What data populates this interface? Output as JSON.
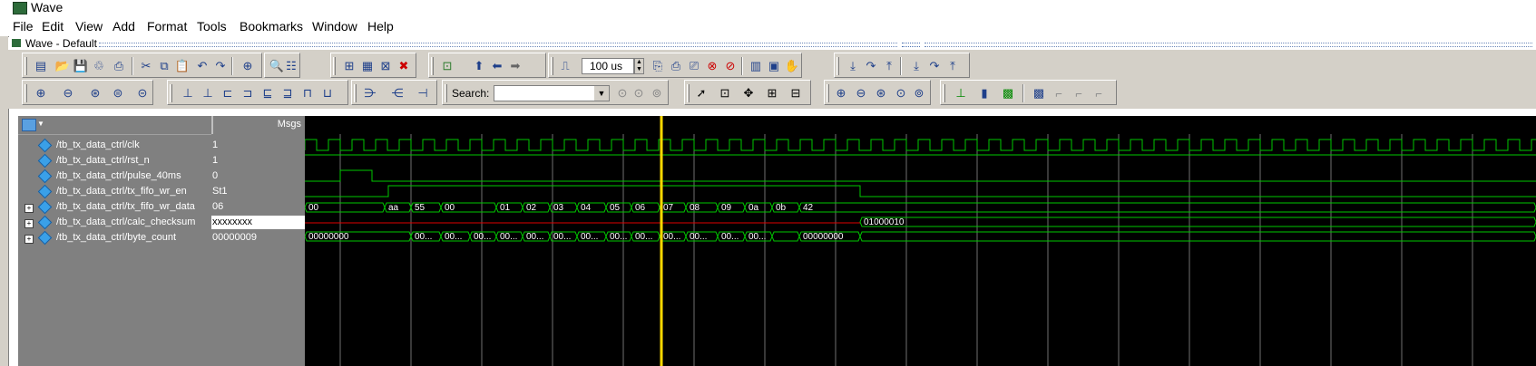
{
  "window": {
    "title": "Wave"
  },
  "menu": [
    "File",
    "Edit",
    "View",
    "Add",
    "Format",
    "Tools",
    "Bookmarks",
    "Window",
    "Help"
  ],
  "pane": {
    "title": "Wave - Default"
  },
  "toolbar": {
    "time_value": "100 us",
    "search_label": "Search:",
    "search_value": "",
    "icons_row1": [
      "new-icon",
      "open-icon",
      "save-icon",
      "reload-icon",
      "print-icon",
      "cut-icon",
      "copy-icon",
      "paste-icon",
      "undo-icon",
      "redo-icon",
      "add-icon",
      "find-icon",
      "format-icon",
      "compile-icon",
      "simulate-icon",
      "break-icon",
      "stop-icon",
      "restart-icon",
      "up-icon",
      "back-icon",
      "forward-icon",
      "run-length-icon",
      "run-icon",
      "continue-icon",
      "run-all-icon",
      "break-all-icon",
      "stop-sim-icon",
      "performance-icon",
      "memory-icon",
      "hand-icon",
      "step-into-icon",
      "step-over-icon",
      "step-out-icon",
      "step-into-2-icon",
      "step-over-2-icon",
      "step-out-2-icon"
    ],
    "icons_row2": [
      "insert-cursor-icon",
      "delete-cursor-icon",
      "lock-cursor-icon",
      "cursor-edit-icon",
      "cursor-goto-icon",
      "edge-prev-icon",
      "edge-next-icon",
      "falling-edge-icon",
      "rising-edge-icon",
      "glitch-icon",
      "edge-any-icon",
      "edge-neg-icon",
      "expand-icon",
      "collapse-icon",
      "group-icon",
      "search-prev-icon",
      "search-next-icon",
      "search-options-icon",
      "select-icon",
      "zoom-box-icon",
      "move-icon",
      "dataflow-icon",
      "schematic-icon",
      "zoom-in-icon",
      "zoom-out-icon",
      "zoom-full-icon",
      "zoom-cursor-icon",
      "zoom-region-icon",
      "wave-1-icon",
      "wave-2-icon",
      "wave-3-icon",
      "wave-4-icon",
      "wave-5-icon",
      "wave-6-icon",
      "wave-7-icon"
    ]
  },
  "columns": {
    "msgs_label": "Msgs"
  },
  "signals": [
    {
      "name": "/tb_tx_data_ctrl/clk",
      "value": "1",
      "expandable": false
    },
    {
      "name": "/tb_tx_data_ctrl/rst_n",
      "value": "1",
      "expandable": false
    },
    {
      "name": "/tb_tx_data_ctrl/pulse_40ms",
      "value": "0",
      "expandable": false
    },
    {
      "name": "/tb_tx_data_ctrl/tx_fifo_wr_en",
      "value": "St1",
      "expandable": false
    },
    {
      "name": "/tb_tx_data_ctrl/tx_fifo_wr_data",
      "value": "06",
      "expandable": true
    },
    {
      "name": "/tb_tx_data_ctrl/calc_checksum",
      "value": "xxxxxxxx",
      "expandable": true,
      "selected": true
    },
    {
      "name": "/tb_tx_data_ctrl/byte_count",
      "value": "00000009",
      "expandable": true
    }
  ],
  "wave": {
    "data_bus_labels": [
      "00",
      "aa",
      "55",
      "00",
      "01",
      "02",
      "03",
      "04",
      "05",
      "06",
      "07",
      "08",
      "09",
      "0a",
      "0b",
      "42"
    ],
    "checksum_labels": [
      "01000010"
    ],
    "byte_count_labels": [
      "00000000",
      "00...",
      "00...",
      "00...",
      "00...",
      "00...",
      "00...",
      "00...",
      "00...",
      "00...",
      "00...",
      "00...",
      "00...",
      "00...",
      "00000000"
    ],
    "colors": {
      "signal": "#00c800",
      "unknown": "#e00000",
      "cursor": "#ffd800",
      "grid": "#707070"
    }
  }
}
